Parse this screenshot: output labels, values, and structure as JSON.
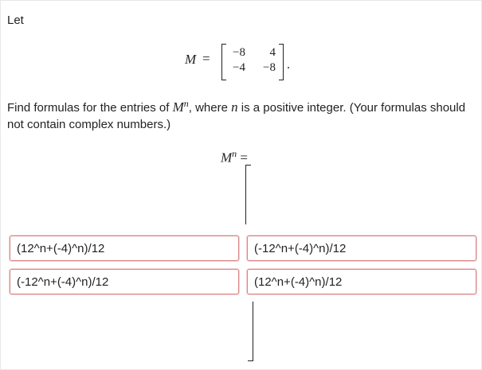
{
  "intro": {
    "let_label": "Let"
  },
  "matrix": {
    "lhs": "M",
    "equals": "=",
    "entries": [
      [
        "−8",
        "4"
      ],
      [
        "−4",
        "−8"
      ]
    ],
    "period": "."
  },
  "prompt": {
    "before": "Find formulas for the entries of ",
    "power_symbol": "M",
    "power_exp": "n",
    "middle": ", where ",
    "n_symbol": "n",
    "after": " is a positive integer. (Your formulas should not contain complex numbers.)"
  },
  "answer": {
    "lhs_base": "M",
    "lhs_exp": "n",
    "equals": "=",
    "entries": {
      "r0c0": "(12^n+(-4)^n)/12",
      "r0c1": "(-12^n+(-4)^n)/12",
      "r1c0": "(-12^n+(-4)^n)/12",
      "r1c1": "(12^n+(-4)^n)/12"
    }
  }
}
